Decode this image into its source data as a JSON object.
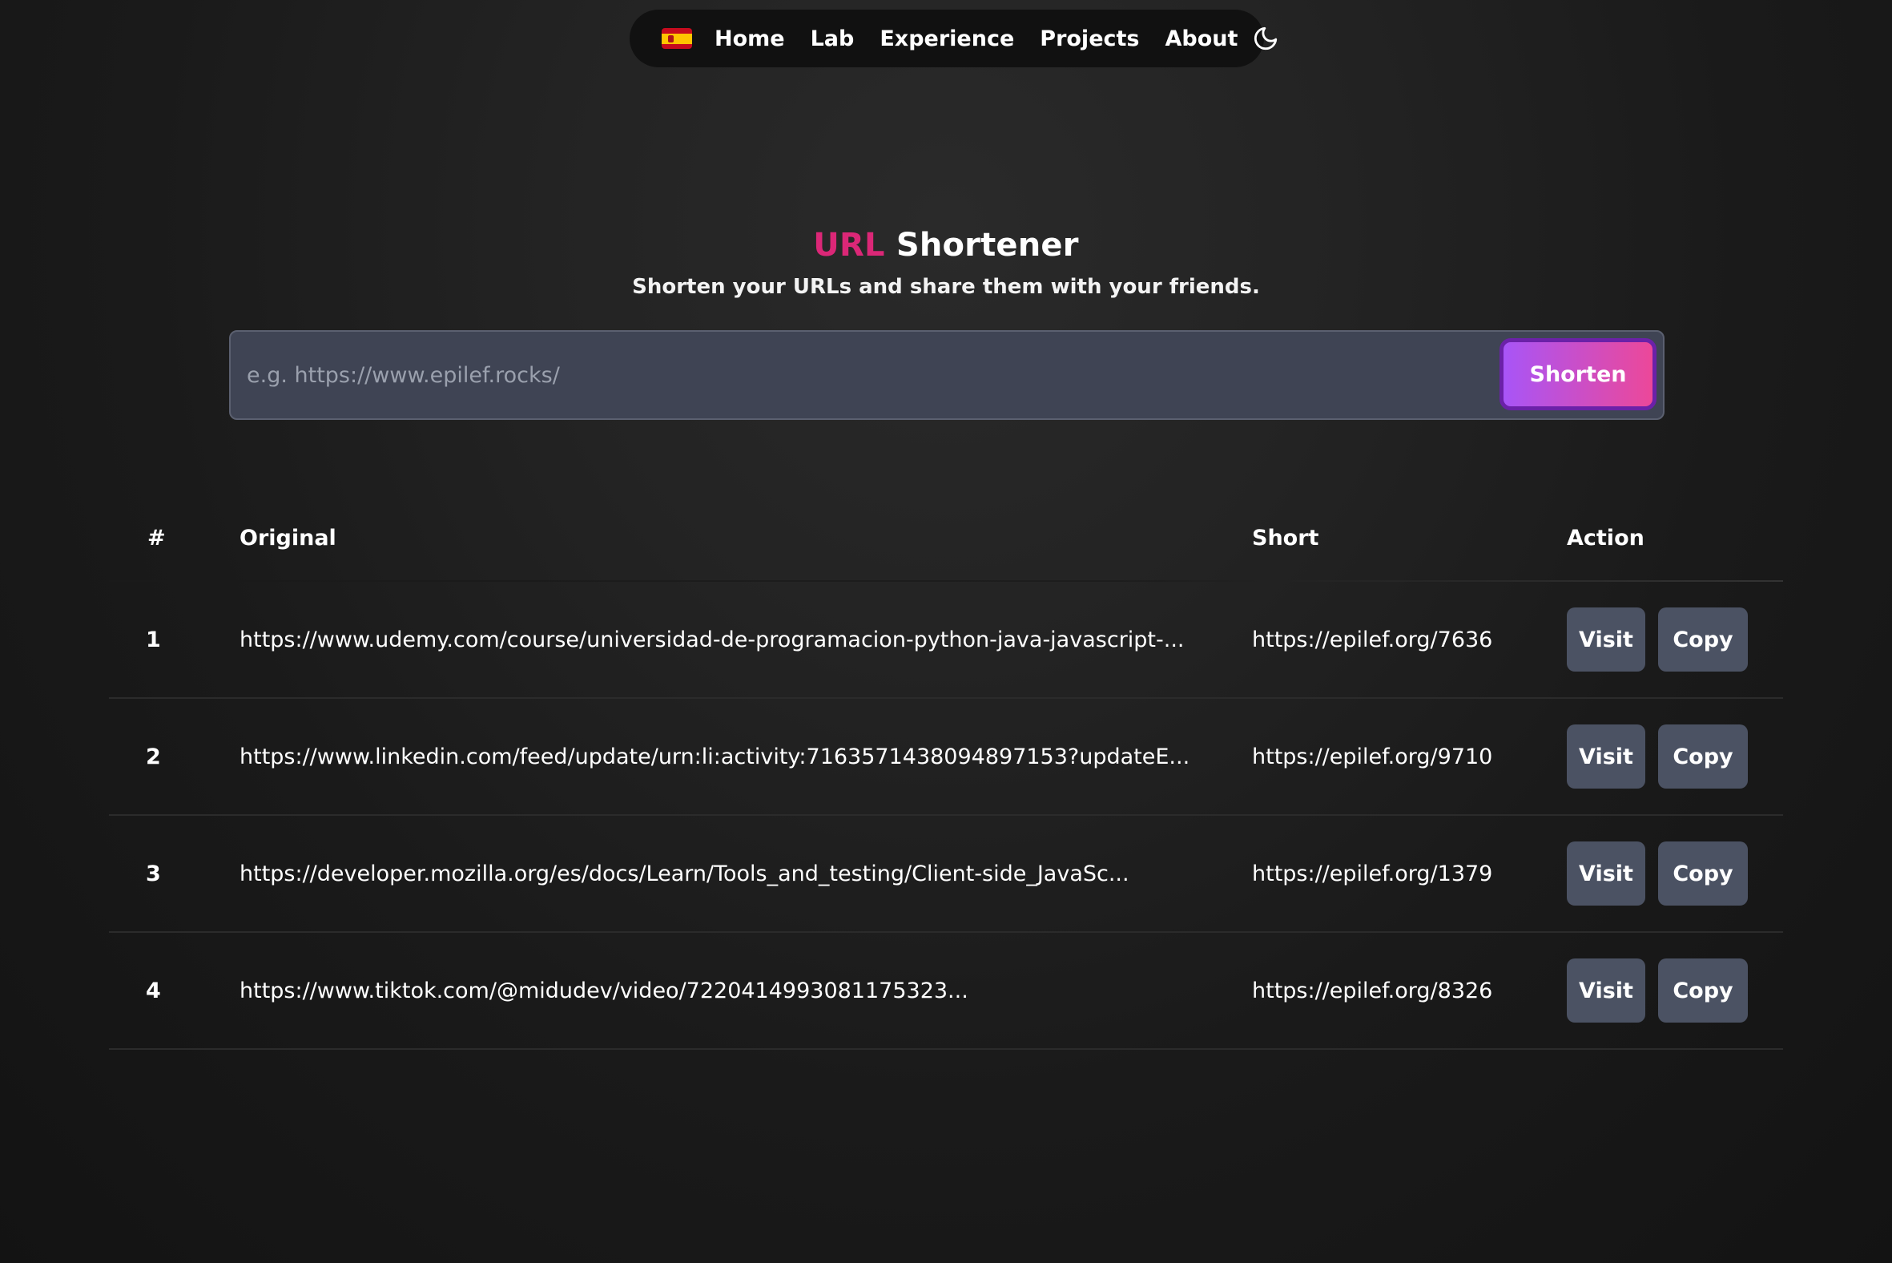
{
  "nav": {
    "links": [
      "Home",
      "Lab",
      "Experience",
      "Projects",
      "About"
    ],
    "theme_icon": "moon-icon",
    "flag_icon": "spain-flag-icon"
  },
  "hero": {
    "title_accent": "URL",
    "title_rest": "Shortener",
    "subtitle": "Shorten your URLs and share them with your friends."
  },
  "form": {
    "placeholder": "e.g. https://www.epilef.rocks/",
    "button_label": "Shorten"
  },
  "table": {
    "headers": [
      "#",
      "Original",
      "Short",
      "Action"
    ],
    "rows": [
      {
        "num": "1",
        "original": "https://www.udemy.com/course/universidad-de-programacion-python-java-javascript-...",
        "short": "https://epilef.org/7636",
        "visit": "Visit",
        "copy": "Copy"
      },
      {
        "num": "2",
        "original": "https://www.linkedin.com/feed/update/urn:li:activity:7163571438094897153?updateE...",
        "short": "https://epilef.org/9710",
        "visit": "Visit",
        "copy": "Copy"
      },
      {
        "num": "3",
        "original": "https://developer.mozilla.org/es/docs/Learn/Tools_and_testing/Client-side_JavaSc...",
        "short": "https://epilef.org/1379",
        "visit": "Visit",
        "copy": "Copy"
      },
      {
        "num": "4",
        "original": "https://www.tiktok.com/@midudev/video/7220414993081175323...",
        "short": "https://epilef.org/8326",
        "visit": "Visit",
        "copy": "Copy"
      }
    ]
  },
  "colors": {
    "accent_pink": "#db2777",
    "button_gradient_start": "#a855f7",
    "button_gradient_end": "#ec4899",
    "action_button_bg": "#4b5263"
  }
}
